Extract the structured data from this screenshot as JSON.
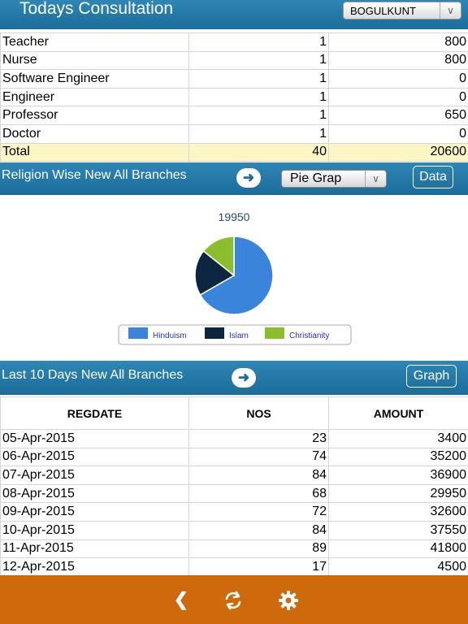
{
  "header": {
    "title": "Todays Consultation",
    "branch": "BOGULKUNT"
  },
  "professions": [
    {
      "name": "Teacher",
      "count": "1",
      "amount": "800"
    },
    {
      "name": "Nurse",
      "count": "1",
      "amount": "800"
    },
    {
      "name": "Software Engineer",
      "count": "1",
      "amount": "0"
    },
    {
      "name": "Engineer",
      "count": "1",
      "amount": "0"
    },
    {
      "name": "Professor",
      "count": "1",
      "amount": "650"
    },
    {
      "name": "Doctor",
      "count": "1",
      "amount": "0"
    }
  ],
  "total": {
    "label": "Total",
    "count": "40",
    "amount": "20600"
  },
  "religion": {
    "label": "Religion Wise New All Branches",
    "chart_type": "Pie Grap",
    "data_button": "Data"
  },
  "chart_data": {
    "type": "pie",
    "title": "19950",
    "slices": [
      {
        "label": "Hinduism",
        "value": 13300,
        "color": "#3a84dc"
      },
      {
        "label": "Islam",
        "value": 3800,
        "color": "#0d2640"
      },
      {
        "label": "Christianity",
        "value": 2850,
        "color": "#8bbd2c"
      }
    ],
    "legend_position": "bottom"
  },
  "days": {
    "label": "Last 10 Days New All Branches",
    "graph_button": "Graph",
    "headers": [
      "REGDATE",
      "NOS",
      "AMOUNT"
    ],
    "rows": [
      {
        "date": "05-Apr-2015",
        "nos": "23",
        "amount": "3400"
      },
      {
        "date": "06-Apr-2015",
        "nos": "74",
        "amount": "35200"
      },
      {
        "date": "07-Apr-2015",
        "nos": "84",
        "amount": "36900"
      },
      {
        "date": "08-Apr-2015",
        "nos": "68",
        "amount": "29950"
      },
      {
        "date": "09-Apr-2015",
        "nos": "72",
        "amount": "32600"
      },
      {
        "date": "10-Apr-2015",
        "nos": "84",
        "amount": "37550"
      },
      {
        "date": "11-Apr-2015",
        "nos": "89",
        "amount": "41800"
      },
      {
        "date": "12-Apr-2015",
        "nos": "17",
        "amount": "4500"
      }
    ]
  },
  "footer": {
    "icons": [
      "back-icon",
      "refresh-icon",
      "settings-icon"
    ]
  }
}
